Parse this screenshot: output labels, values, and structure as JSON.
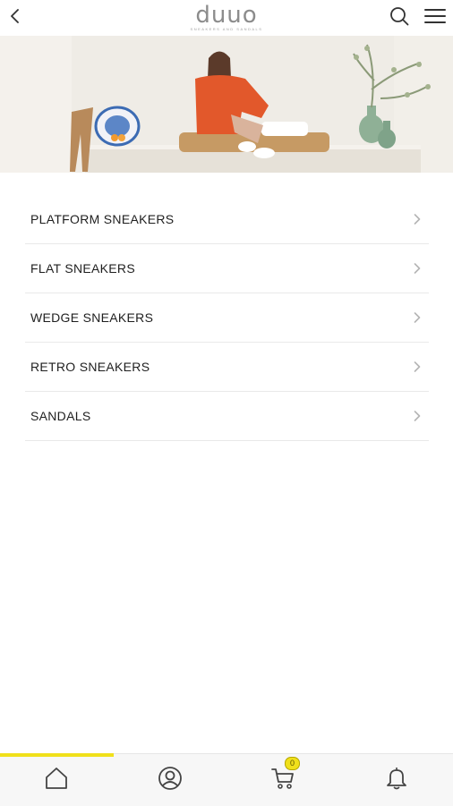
{
  "header": {
    "back_icon": "chevron-left-icon",
    "logo_text": "duuo",
    "logo_tagline": "SNEAKERS AND SANDALS",
    "search_icon": "search-icon",
    "menu_icon": "hamburger-menu-icon"
  },
  "hero": {
    "image": "lifestyle photo: woman in orange outfit sitting on a cushion beside ceramic plate, wooden stool and green vases"
  },
  "categories": [
    {
      "label": "PLATFORM SNEAKERS"
    },
    {
      "label": "FLAT SNEAKERS"
    },
    {
      "label": "WEDGE SNEAKERS"
    },
    {
      "label": "RETRO SNEAKERS"
    },
    {
      "label": "SANDALS"
    }
  ],
  "tabbar": {
    "active_tab": "home",
    "accent_color": "#f0e01b",
    "items": [
      {
        "icon": "home-icon"
      },
      {
        "icon": "user-circle-icon"
      },
      {
        "icon": "cart-icon",
        "badge": "0"
      },
      {
        "icon": "bell-icon"
      }
    ]
  }
}
